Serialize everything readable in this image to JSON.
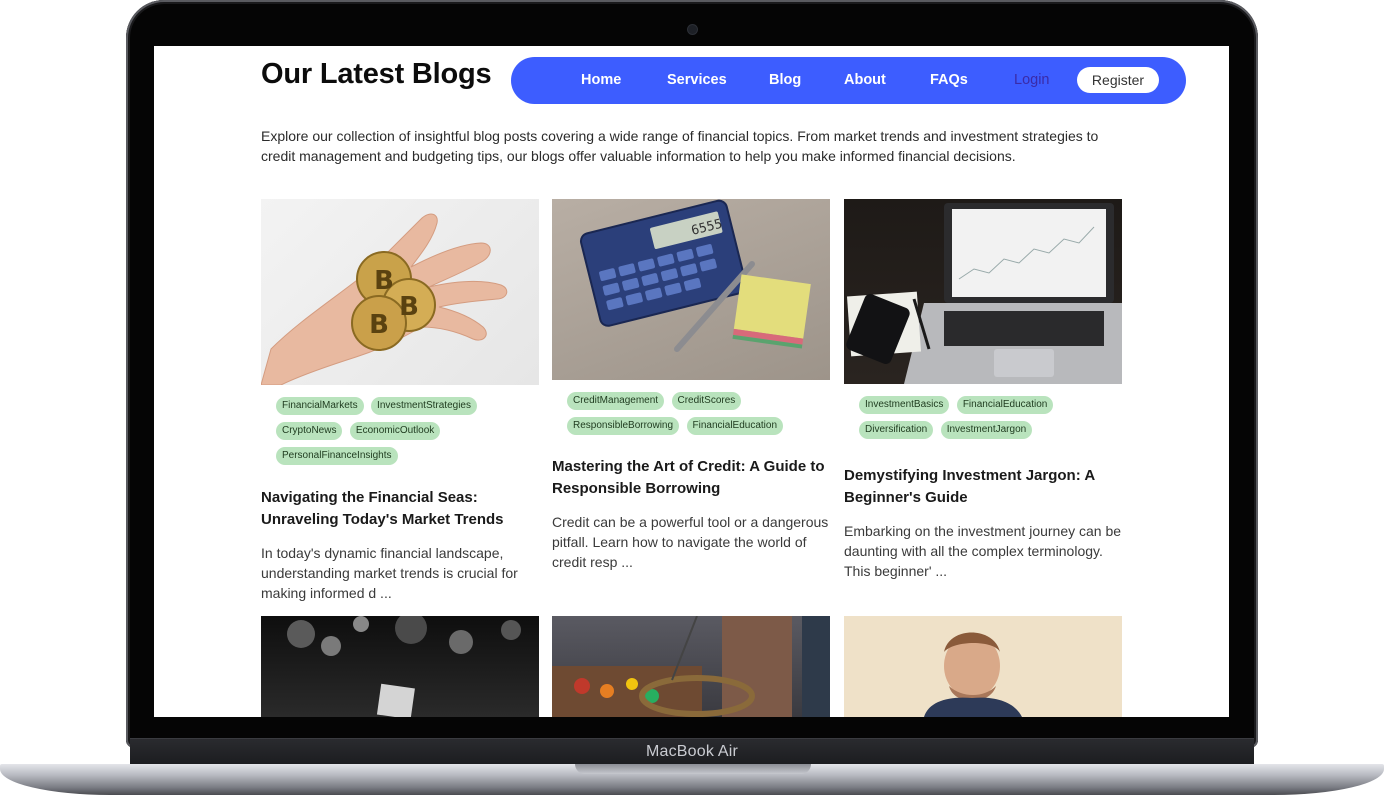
{
  "device": {
    "label": "MacBook Air"
  },
  "page": {
    "title": "Our Latest Blogs",
    "intro": "Explore our collection of insightful blog posts covering a wide range of financial topics. From market trends and investment strategies to credit management and budgeting tips, our blogs offer valuable information to help you make informed financial decisions."
  },
  "nav": {
    "items": [
      "Home",
      "Services",
      "Blog",
      "About",
      "FAQs"
    ],
    "login": "Login",
    "register": "Register"
  },
  "posts": [
    {
      "tags": [
        "FinancialMarkets",
        "InvestmentStrategies",
        "CryptoNews",
        "EconomicOutlook",
        "PersonalFinanceInsights"
      ],
      "title": "Navigating the Financial Seas: Unraveling Today's Market Trends",
      "excerpt": "In today's dynamic financial landscape, understanding market trends is crucial for making informed d ..."
    },
    {
      "tags": [
        "CreditManagement",
        "CreditScores",
        "ResponsibleBorrowing",
        "FinancialEducation"
      ],
      "title": "Mastering the Art of Credit: A Guide to Responsible Borrowing",
      "excerpt": "Credit can be a powerful tool or a dangerous pitfall. Learn how to navigate the world of credit resp ..."
    },
    {
      "tags": [
        "InvestmentBasics",
        "FinancialEducation",
        "Diversification",
        "InvestmentJargon"
      ],
      "title": "Demystifying Investment Jargon: A Beginner's Guide",
      "excerpt": "Embarking on the investment journey can be daunting with all the complex terminology. This beginner' ..."
    }
  ],
  "colors": {
    "nav_background": "#3d5dff",
    "tag_background": "#b9e3bd",
    "title_text": "#0c0c0c"
  },
  "icons": [
    "camera-dot"
  ]
}
